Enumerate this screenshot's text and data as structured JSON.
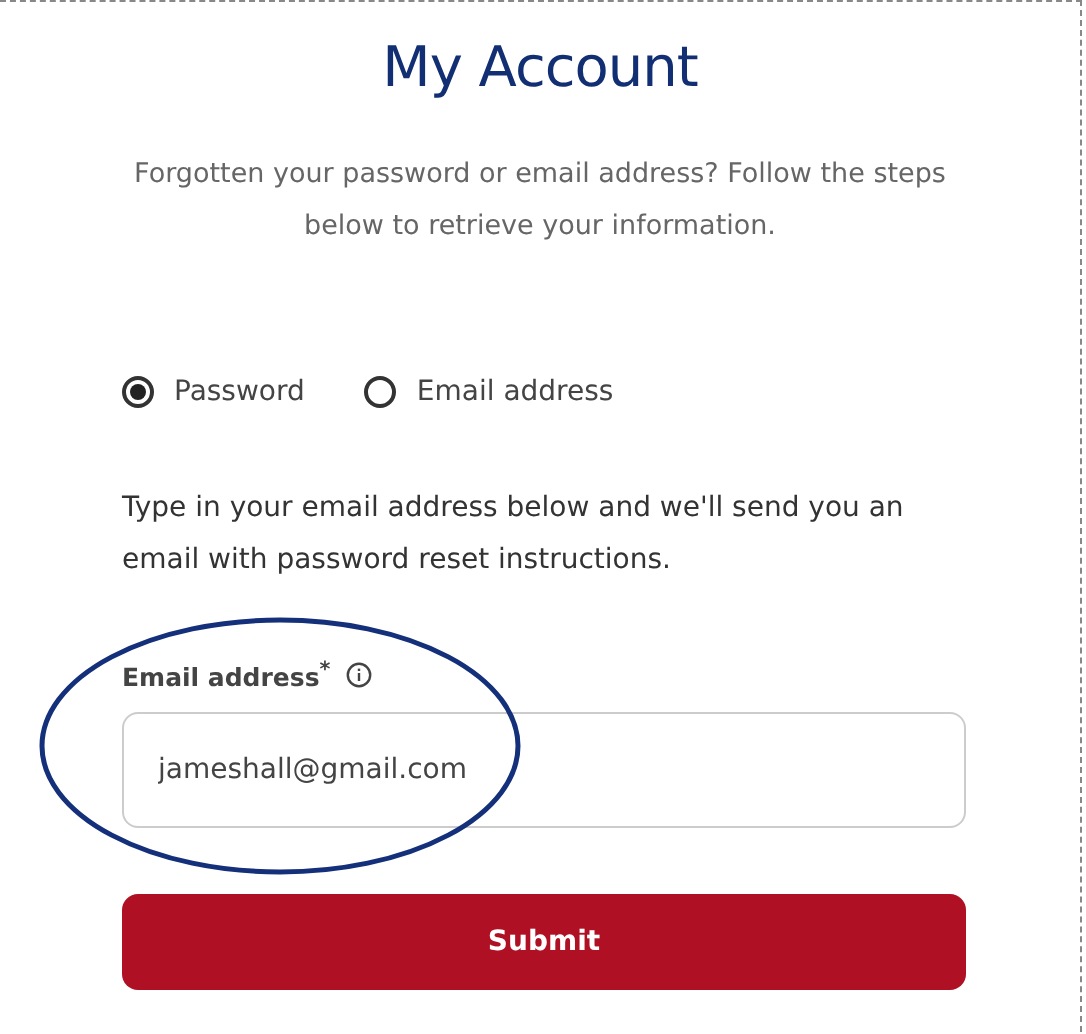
{
  "title": "My Account",
  "intro": "Forgotten your password or email address? Follow the steps below to retrieve your information.",
  "options": [
    {
      "label": "Password",
      "selected": true
    },
    {
      "label": "Email address",
      "selected": false
    }
  ],
  "instructions": "Type in your email address below and we'll send you an email with password reset instructions.",
  "email_field": {
    "label": "Email address$^{*}$",
    "value": "jameshall@gmail.com"
  },
  "submit_button": "Submit"
}
